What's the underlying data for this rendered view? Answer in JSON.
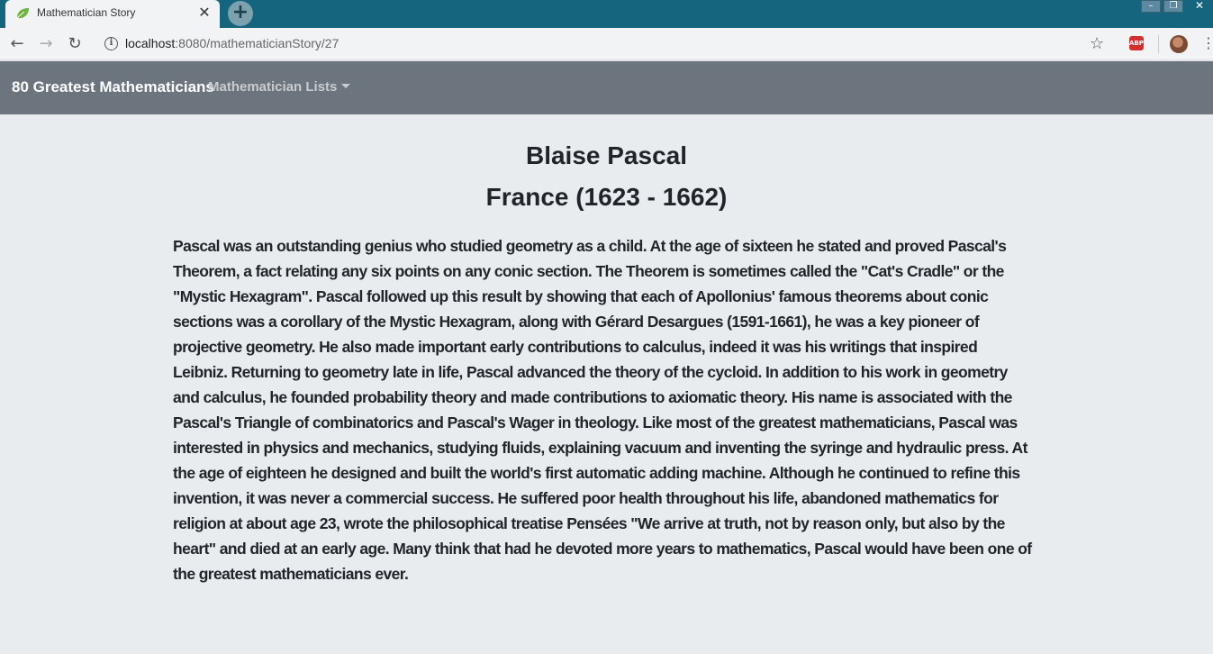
{
  "browser": {
    "tab_title": "Mathematician Story",
    "tab_close": "✕",
    "new_tab": "+",
    "url_host": "localhost",
    "url_path": ":8080/mathematicianStory/27",
    "window_controls": {
      "minimize": "–",
      "maximize": "❐",
      "close": "✕"
    },
    "extension_badge": "ABP"
  },
  "navbar": {
    "brand": "80 Greatest Mathematicians",
    "dropdown_label": "Mathematician Lists"
  },
  "mathematician": {
    "name": "Blaise Pascal",
    "country_years": "France (1623 - 1662)",
    "story": "Pascal was an outstanding genius who studied geometry as a child. At the age of sixteen he stated and proved Pascal's Theorem, a fact relating any six points on any conic section. The Theorem is sometimes called the \"Cat's Cradle\" or the \"Mystic Hexagram\". Pascal followed up this result by showing that each of Apollonius' famous theorems about conic sections was a corollary of the Mystic Hexagram, along with Gérard Desargues (1591-1661), he was a key pioneer of projective geometry. He also made important early contributions to calculus, indeed it was his writings that inspired Leibniz. Returning to geometry late in life, Pascal advanced the theory of the cycloid. In addition to his work in geometry and calculus, he founded probability theory and made contributions to axiomatic theory. His name is associated with the Pascal's Triangle of combinatorics and Pascal's Wager in theology. Like most of the greatest mathematicians, Pascal was interested in physics and mechanics, studying fluids, explaining vacuum and inventing the syringe and hydraulic press. At the age of eighteen he designed and built the world's first automatic adding machine. Although he continued to refine this invention, it was never a commercial success. He suffered poor health throughout his life, abandoned mathematics for religion at about age 23, wrote the philosophical treatise Pensées \"We arrive at truth, not by reason only, but also by the heart\" and died at an early age. Many think that had he devoted more years to mathematics, Pascal would have been one of the greatest mathematicians ever."
  },
  "colors": {
    "titlebar": "#15657f",
    "navbar": "#6c757d",
    "page_background": "#e9ecef",
    "text": "#212529"
  }
}
